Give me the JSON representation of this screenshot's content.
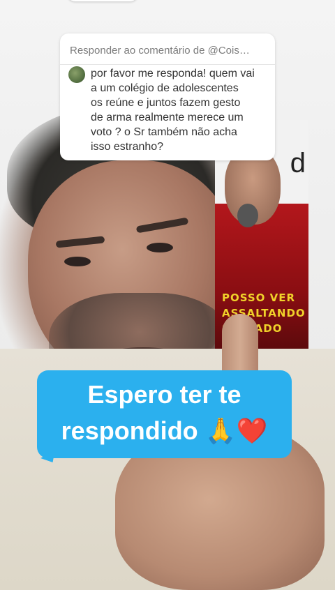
{
  "reply_card": {
    "header": "Responder ao comentário de @Cois…",
    "comment_lines": [
      "por favor me responda! quem vai",
      "a um colégio de adolescentes",
      "os reúne e juntos fazem gesto",
      "de arma realmente merece um",
      "voto ? o Sr também não acha",
      "isso estranho?"
    ]
  },
  "poster": {
    "letter": "d",
    "lines": [
      "POSSO VER",
      "ASSALTANDO",
      "SENTADO"
    ]
  },
  "caption": {
    "line1": "Espero ter te",
    "line2": "respondido 🙏❤️"
  },
  "colors": {
    "caption_bg": "#2bb0ee",
    "poster_text": "#f0d22a",
    "poster_red": "#b3171c"
  }
}
